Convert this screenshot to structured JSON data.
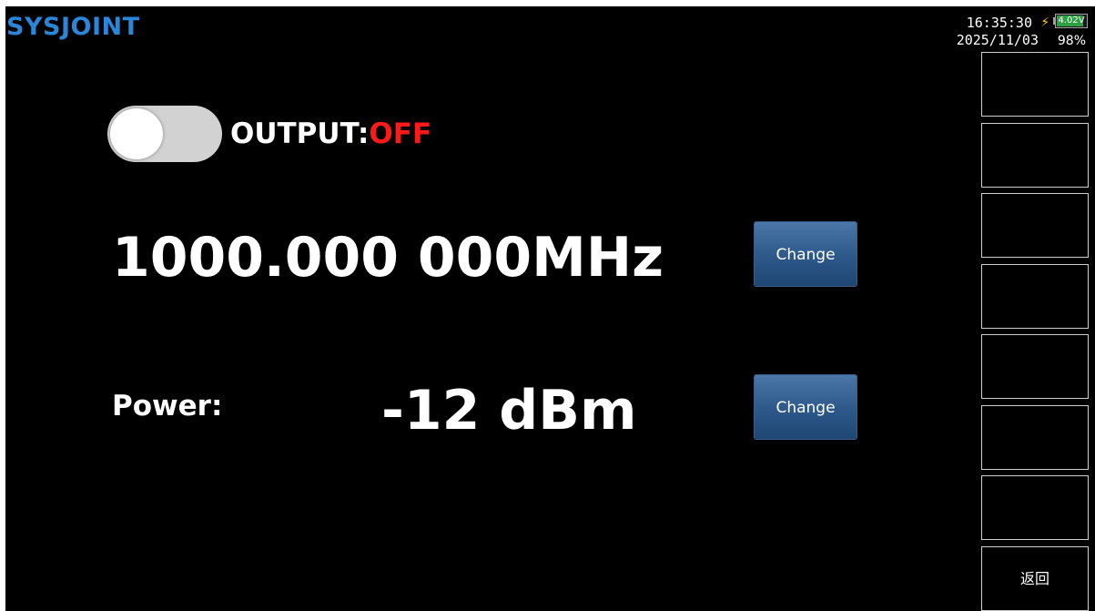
{
  "header": {
    "brand": "SYSJOINT",
    "time": "16:35:30",
    "date": "2025/11/03",
    "battery_voltage": "4.02V",
    "battery_percent": "98%",
    "battery_level": 0.98,
    "charging": true,
    "charging_icon": "lightning-bolt-icon"
  },
  "output": {
    "label": "OUTPUT:",
    "state": "OFF",
    "enabled": false
  },
  "frequency": {
    "value": "1000.000 000MHz",
    "change_label": "Change"
  },
  "power": {
    "label": "Power:",
    "value": "-12 dBm",
    "change_label": "Change"
  },
  "softkeys": [
    "",
    "",
    "",
    "",
    "",
    "",
    "",
    "返回"
  ],
  "colors": {
    "background": "#000000",
    "brand_blue": "#1e6fc0",
    "output_off": "#ff1a1a",
    "button_blue": "#2f5a8c",
    "charging": "#ffcc00",
    "battery_fill": "#2ea043"
  }
}
